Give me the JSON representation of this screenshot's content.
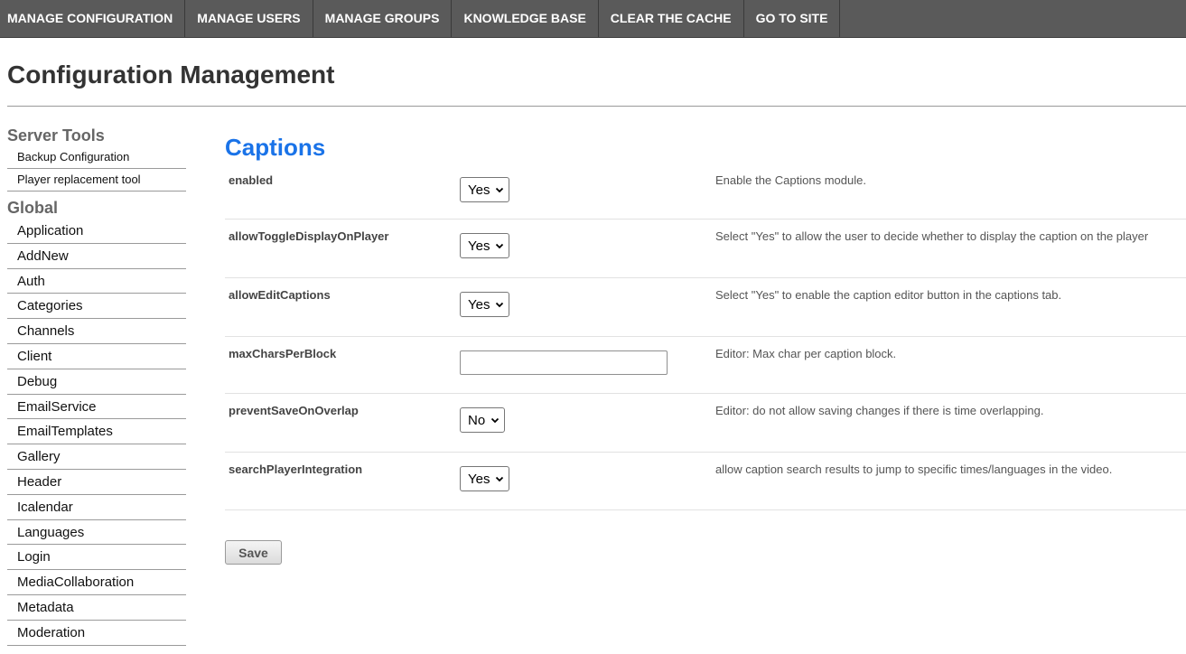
{
  "nav": {
    "items": [
      {
        "label": "MANAGE CONFIGURATION"
      },
      {
        "label": "MANAGE USERS"
      },
      {
        "label": "MANAGE GROUPS"
      },
      {
        "label": "KNOWLEDGE BASE"
      },
      {
        "label": "CLEAR THE CACHE"
      },
      {
        "label": "GO TO SITE"
      }
    ]
  },
  "page": {
    "title": "Configuration Management"
  },
  "sidebar": {
    "server_tools_title": "Server Tools",
    "server_tools": [
      {
        "label": "Backup Configuration"
      },
      {
        "label": "Player replacement tool"
      }
    ],
    "global_title": "Global",
    "global": [
      {
        "label": "Application"
      },
      {
        "label": "AddNew"
      },
      {
        "label": "Auth"
      },
      {
        "label": "Categories"
      },
      {
        "label": "Channels"
      },
      {
        "label": "Client"
      },
      {
        "label": "Debug"
      },
      {
        "label": "EmailService"
      },
      {
        "label": "EmailTemplates"
      },
      {
        "label": "Gallery"
      },
      {
        "label": "Header"
      },
      {
        "label": "Icalendar"
      },
      {
        "label": "Languages"
      },
      {
        "label": "Login"
      },
      {
        "label": "MediaCollaboration"
      },
      {
        "label": "Metadata"
      },
      {
        "label": "Moderation"
      }
    ]
  },
  "main": {
    "heading": "Captions",
    "rows": [
      {
        "name": "enabled",
        "value": "Yes",
        "description": "Enable the Captions module."
      },
      {
        "name": "allowToggleDisplayOnPlayer",
        "value": "Yes",
        "description": "Select \"Yes\" to allow the user to decide whether to display the caption on the player"
      },
      {
        "name": "allowEditCaptions",
        "value": "Yes",
        "description": "Select \"Yes\" to enable the caption editor button in the captions tab."
      },
      {
        "name": "maxCharsPerBlock",
        "value": "",
        "description": "Editor: Max char per caption block."
      },
      {
        "name": "preventSaveOnOverlap",
        "value": "No",
        "description": "Editor: do not allow saving changes if there is time overlapping."
      },
      {
        "name": "searchPlayerIntegration",
        "value": "Yes",
        "description": "allow caption search results to jump to specific times/languages in the video."
      }
    ],
    "save_label": "Save"
  },
  "colors": {
    "nav_bg": "#5a5a5a",
    "heading_blue": "#1a73e8"
  }
}
